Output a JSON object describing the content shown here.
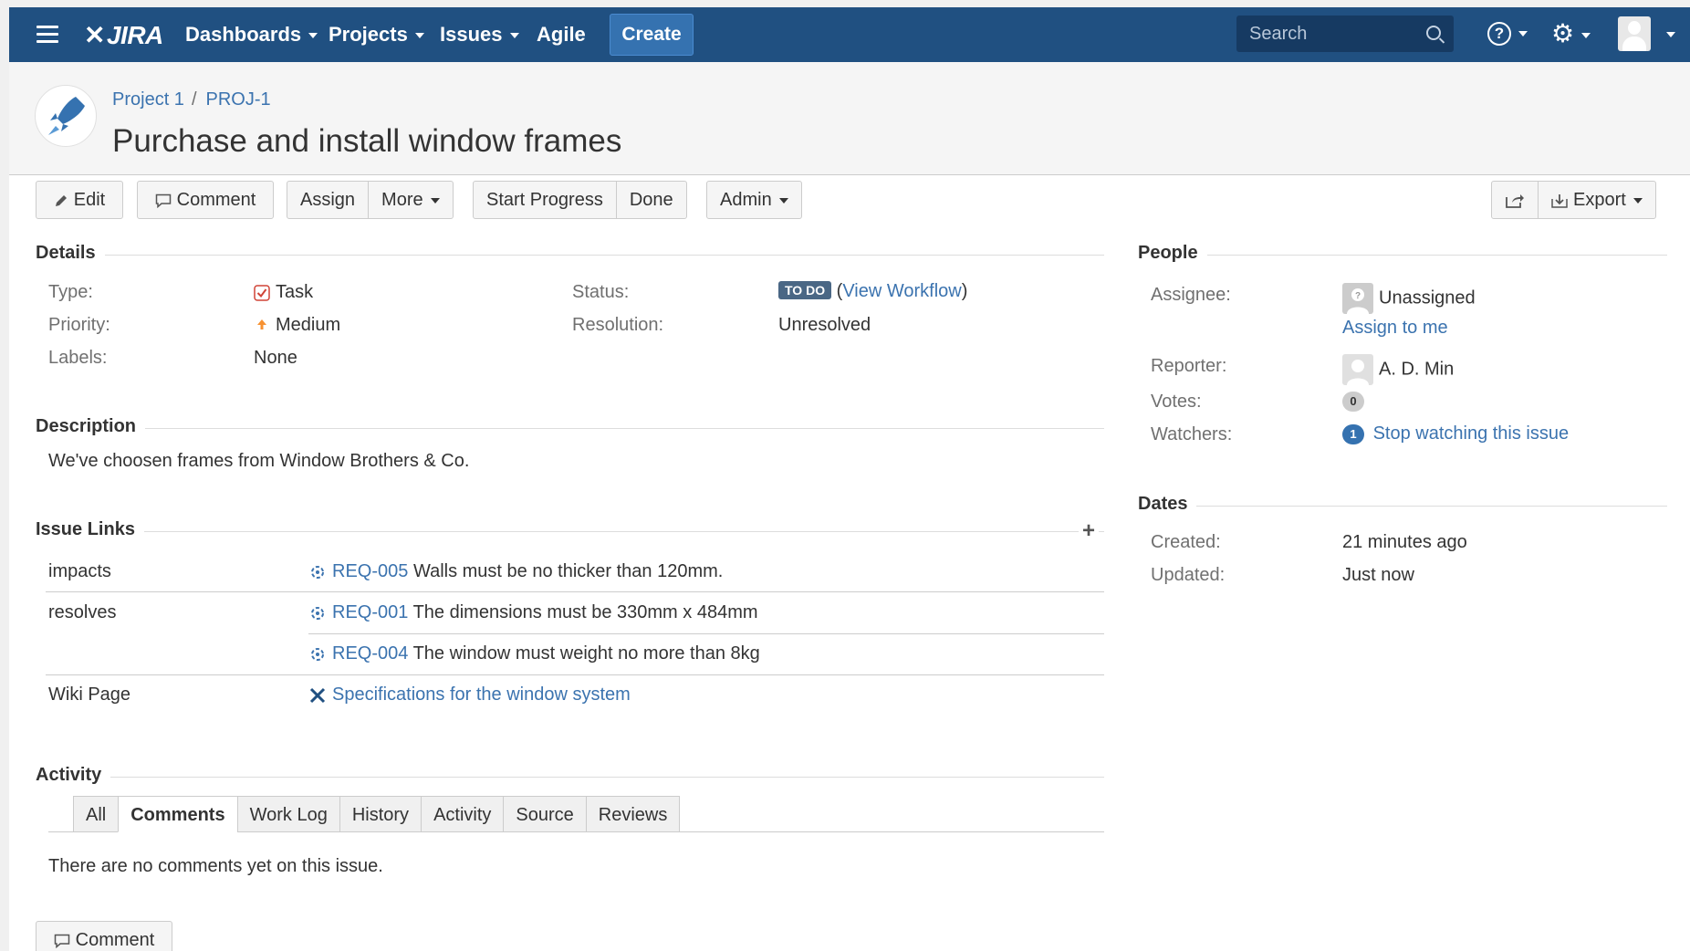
{
  "nav": {
    "logo": "JIRA",
    "items": [
      "Dashboards",
      "Projects",
      "Issues",
      "Agile"
    ],
    "create_label": "Create",
    "search_placeholder": "Search",
    "help": "?"
  },
  "breadcrumb": {
    "project": "Project 1",
    "sep": "/",
    "issue_key": "PROJ-1"
  },
  "issue": {
    "title": "Purchase and install window frames"
  },
  "toolbar": {
    "edit": "Edit",
    "comment": "Comment",
    "assign": "Assign",
    "more": "More",
    "start_progress": "Start Progress",
    "done": "Done",
    "admin": "Admin",
    "export": "Export"
  },
  "details": {
    "heading": "Details",
    "type_label": "Type:",
    "type_value": "Task",
    "priority_label": "Priority:",
    "priority_value": "Medium",
    "labels_label": "Labels:",
    "labels_value": "None",
    "status_label": "Status:",
    "status_value": "TO DO",
    "view_workflow": "View Workflow",
    "resolution_label": "Resolution:",
    "resolution_value": "Unresolved"
  },
  "description": {
    "heading": "Description",
    "text": "We've choosen frames from Window Brothers & Co."
  },
  "issue_links": {
    "heading": "Issue Links",
    "rows": [
      {
        "type": "impacts",
        "key": "REQ-005",
        "summary": "Walls must be no thicker than 120mm."
      },
      {
        "type": "resolves",
        "key": "REQ-001",
        "summary": "The dimensions must be 330mm x 484mm"
      },
      {
        "type": "",
        "key": "REQ-004",
        "summary": "The window must weight no more than 8kg"
      },
      {
        "type": "Wiki Page",
        "key": "",
        "summary": "Specifications for the window system"
      }
    ]
  },
  "activity": {
    "heading": "Activity",
    "tabs": [
      "All",
      "Comments",
      "Work Log",
      "History",
      "Activity",
      "Source",
      "Reviews"
    ],
    "active_tab": "Comments",
    "empty_text": "There are no comments yet on this issue.",
    "comment_button": "Comment"
  },
  "people": {
    "heading": "People",
    "assignee_label": "Assignee:",
    "assignee_value": "Unassigned",
    "assign_to_me": "Assign to me",
    "reporter_label": "Reporter:",
    "reporter_value": "A. D. Min",
    "votes_label": "Votes:",
    "votes_count": "0",
    "watchers_label": "Watchers:",
    "watchers_count": "1",
    "stop_watching": "Stop watching this issue"
  },
  "dates": {
    "heading": "Dates",
    "created_label": "Created:",
    "created_value": "21 minutes ago",
    "updated_label": "Updated:",
    "updated_value": "Just now"
  },
  "colors": {
    "nav": "#205081",
    "link": "#3b73af",
    "lozenge": "#4a6785"
  }
}
